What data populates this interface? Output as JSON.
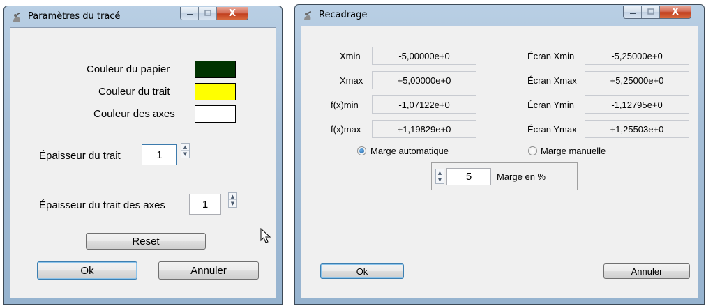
{
  "dialog_trace": {
    "title": "Paramètres du tracé",
    "caption": {
      "minimize": "▭",
      "maximize": "▢",
      "close": "X"
    },
    "paper_color_label": "Couleur du papier",
    "line_color_label": "Couleur du trait",
    "axes_color_label": "Couleur des axes",
    "colors": {
      "paper": "#003300",
      "line": "#ffff00",
      "axes": "#ffffff"
    },
    "line_thickness_label": "Épaisseur du trait",
    "line_thickness_value": "1",
    "axes_thickness_label": "Épaisseur du trait des axes",
    "axes_thickness_value": "1",
    "reset_label": "Reset",
    "ok_label": "Ok",
    "cancel_label": "Annuler"
  },
  "dialog_recadrage": {
    "title": "Recadrage",
    "caption": {
      "minimize": "▭",
      "maximize": "▢",
      "close": "X"
    },
    "rows": [
      {
        "label": "Xmin",
        "value": "-5,00000e+0",
        "screen_label": "Écran Xmin",
        "screen_value": "-5,25000e+0"
      },
      {
        "label": "Xmax",
        "value": "+5,00000e+0",
        "screen_label": "Écran Xmax",
        "screen_value": "+5,25000e+0"
      },
      {
        "label": "f(x)min",
        "value": "-1,07122e+0",
        "screen_label": "Écran Ymin",
        "screen_value": "-1,12795e+0"
      },
      {
        "label": "f(x)max",
        "value": "+1,19829e+0",
        "screen_label": "Écran Ymax",
        "screen_value": "+1,25503e+0"
      }
    ],
    "margin_auto_label": "Marge automatique",
    "margin_manual_label": "Marge manuelle",
    "margin_mode": "automatique",
    "margin_value": "5",
    "margin_unit_label": "Marge en %",
    "ok_label": "Ok",
    "cancel_label": "Annuler"
  }
}
